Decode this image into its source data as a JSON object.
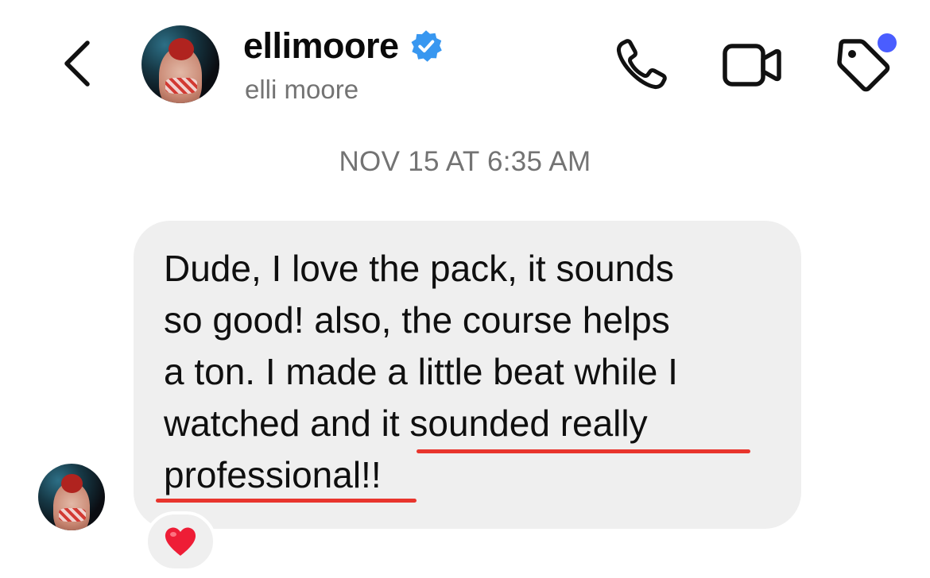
{
  "header": {
    "username": "ellimoore",
    "display_name": "elli moore",
    "verified": true,
    "icons": {
      "back": "chevron-left-icon",
      "call": "phone-icon",
      "video": "video-camera-icon",
      "tag": "tag-icon"
    },
    "notification_dot_color": "#4a5dff",
    "verified_color": "#3897f0"
  },
  "thread": {
    "timestamp": "NOV 15 AT 6:35 AM",
    "messages": [
      {
        "text": "Dude, I love the pack, it sounds\nso good! also, the course helps\na ton. I made a little beat while I\nwatched and it sounded really\nprofessional!!",
        "reaction": "❤️",
        "highlight_color": "#e8352d"
      }
    ]
  }
}
